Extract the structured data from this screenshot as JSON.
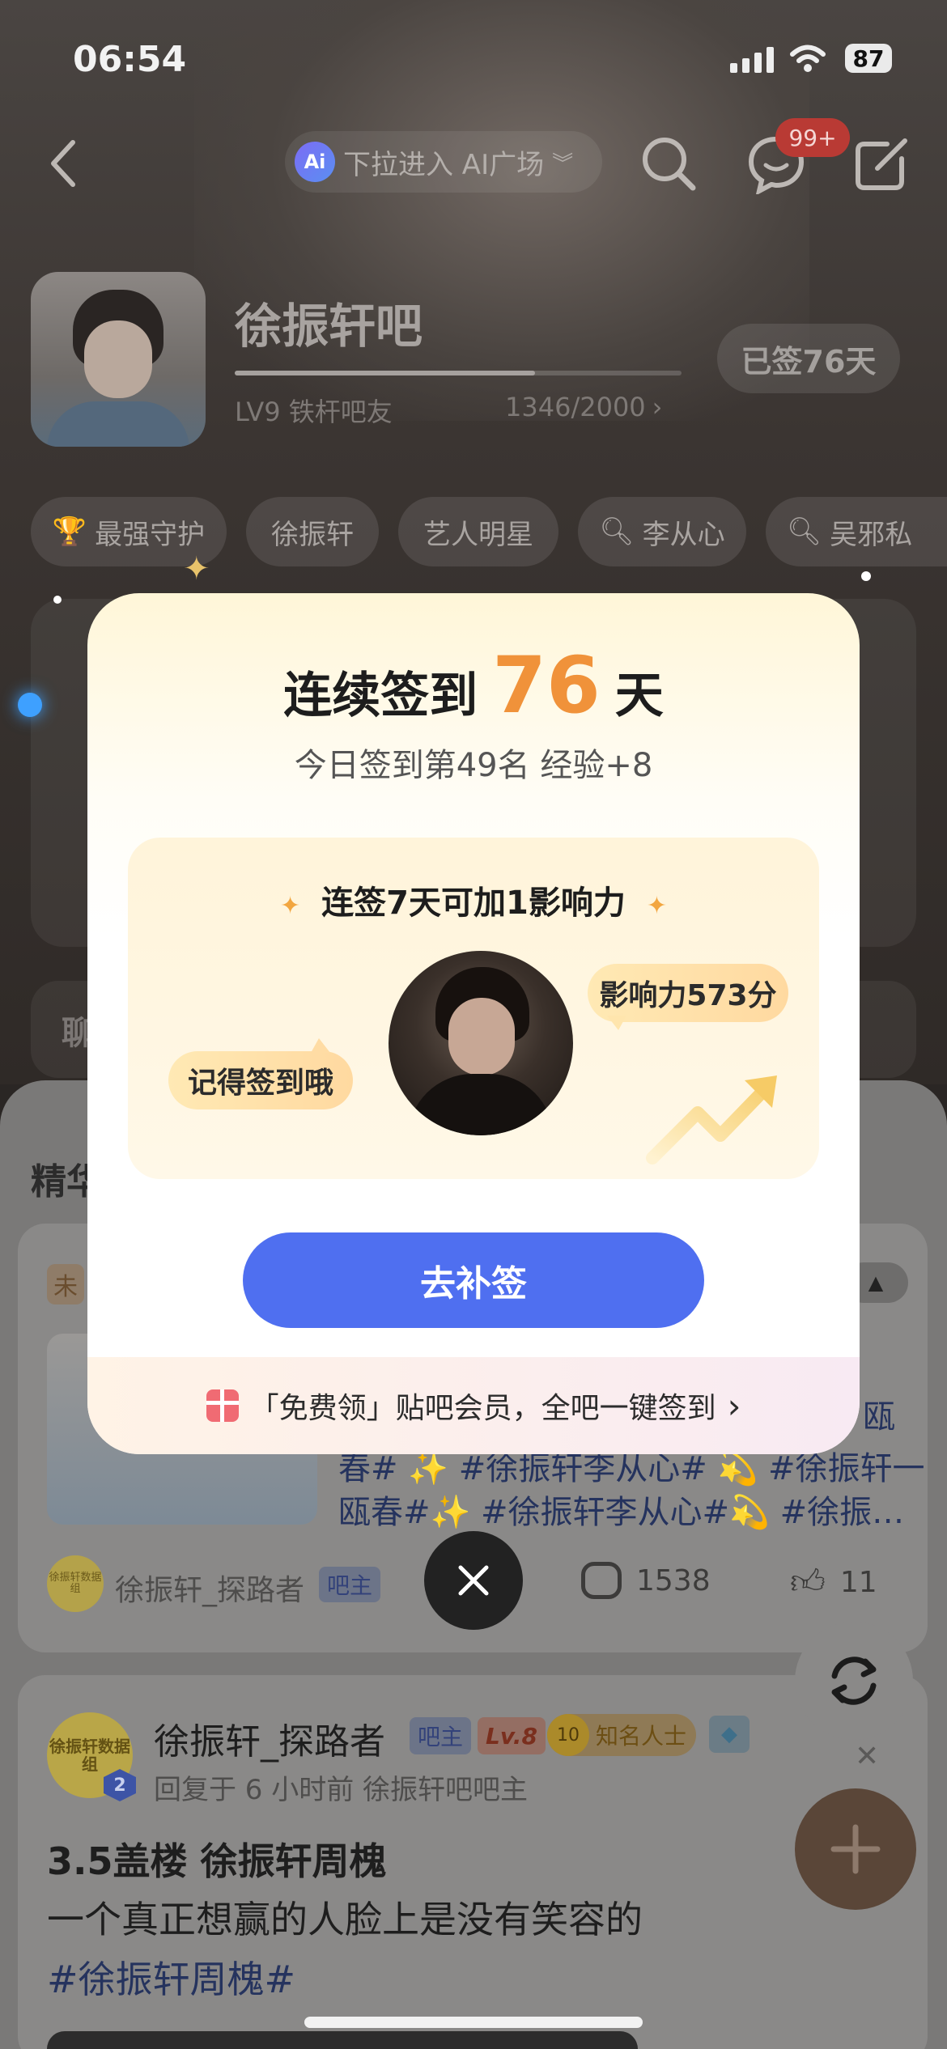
{
  "status_bar": {
    "time": "06:54",
    "battery": "87"
  },
  "header": {
    "ai_plaza_label": "下拉进入 AI广场",
    "messages_badge": "99+"
  },
  "forum": {
    "name": "徐振轩吧",
    "level_label": "LV9 铁杆吧友",
    "exp_progress_text": "1346/2000",
    "exp_progress_fraction": 0.673,
    "signed_label": "已签76天"
  },
  "tags": [
    "最强守护",
    "徐振轩",
    "艺人明星",
    "李从心",
    "吴邪私"
  ],
  "partial_section_label": "聊",
  "feed": {
    "section_label": "精华",
    "post1": {
      "tag": "未",
      "text_line1": "瓯",
      "text_line2": "春# ✨ #徐振轩李从心# 💫 #徐振轩一",
      "text_line3": "瓯春#✨ #徐振轩李从心#💫 #徐振…",
      "author": "徐振轩_探路者",
      "role_badge": "吧主",
      "avatar_text": "徐振轩数据组",
      "comments": "1538",
      "likes": "11"
    },
    "post2": {
      "author": "徐振轩_探路者",
      "role_badge": "吧主",
      "level_badge": "Lv.8",
      "level_number": "10",
      "fame_badge": "知名人士",
      "avatar_text": "徐振轩数据组",
      "avatar_level": "2",
      "meta": "回复于 6 小时前  徐振轩吧吧主",
      "title": "3.5盖楼 徐振轩周槐",
      "body": "一个真正想赢的人脸上是没有笑容的",
      "hashtag": "#徐振轩周槐#"
    }
  },
  "modal": {
    "title_prefix": "连续签到",
    "streak_days": "76",
    "title_suffix": "天",
    "subtitle": "今日签到第49名 经验+8",
    "reward_title": "连签7天可加1影响力",
    "influence_bubble": "影响力573分",
    "reminder_bubble": "记得签到哦",
    "cta_label": "去补签",
    "footer_text": "「免费领」贴吧会员，全吧一键签到",
    "footer_chevron": "›"
  },
  "icons": {
    "back": "back-chevron-icon",
    "search": "search-icon",
    "message": "message-icon",
    "edit": "edit-icon",
    "close": "close-icon",
    "refresh": "refresh-icon",
    "add": "plus-icon",
    "gift": "gift-icon"
  },
  "colors": {
    "accent_blue": "#4f6ff0",
    "streak_orange": "#f0923a",
    "badge_red": "#e8433d"
  }
}
